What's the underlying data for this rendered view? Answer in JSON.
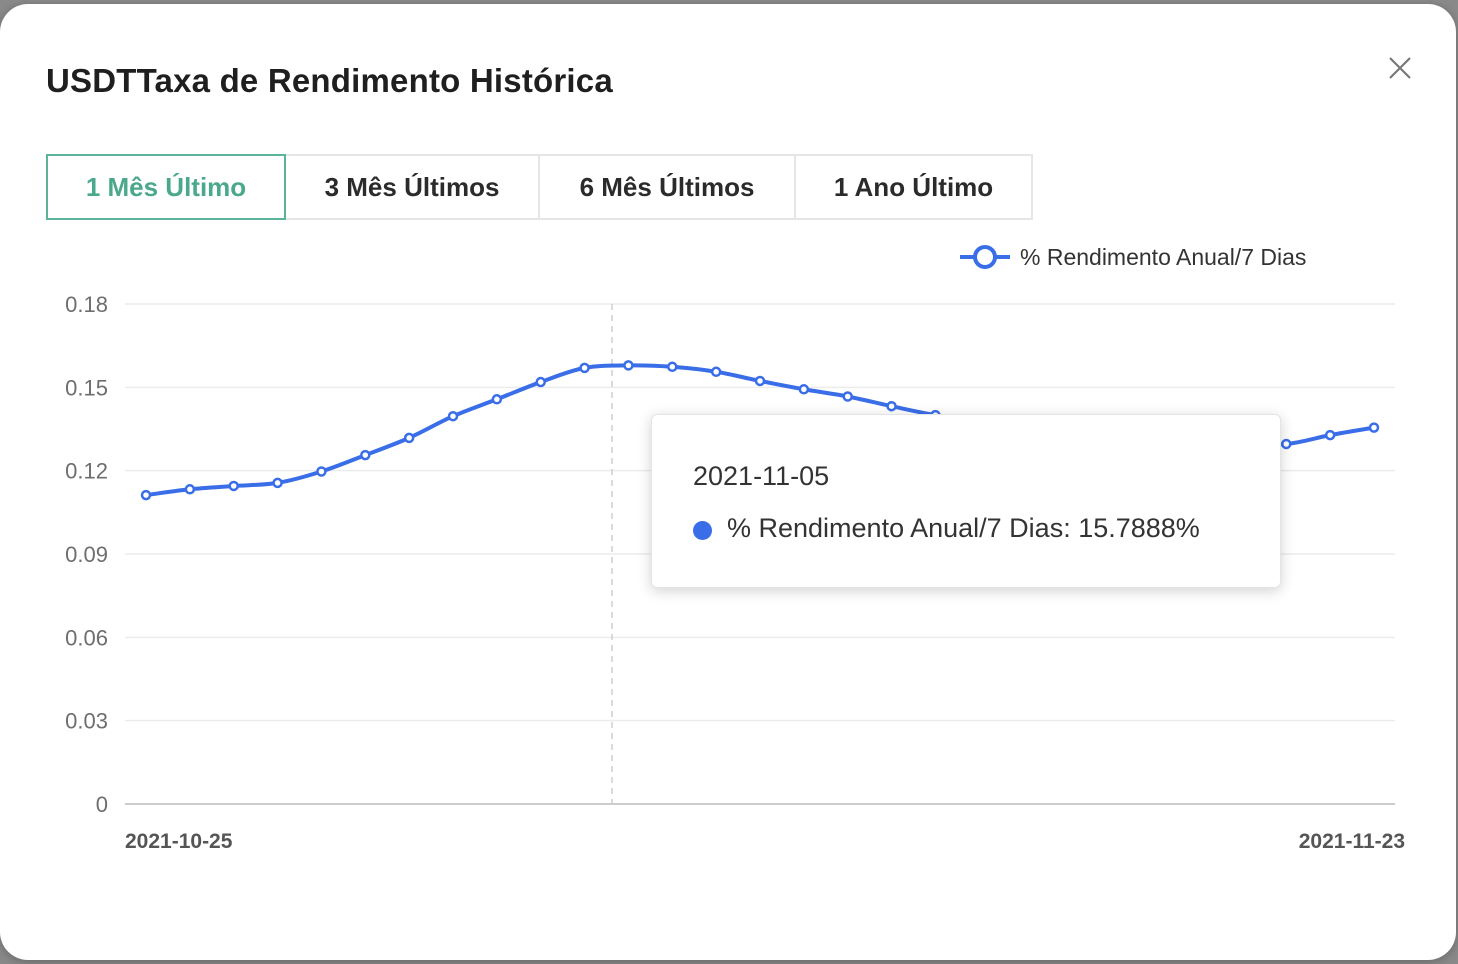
{
  "dialog": {
    "title": "USDTTaxa de Rendimento Histórica",
    "close_icon": "close-icon"
  },
  "tabs": [
    {
      "label": "1 Mês Último",
      "active": true
    },
    {
      "label": "3 Mês Últimos",
      "active": false
    },
    {
      "label": "6 Mês Últimos",
      "active": false
    },
    {
      "label": "1 Ano Último",
      "active": false
    }
  ],
  "colors": {
    "accent": "#4aa88c",
    "series": "#3a6ee8"
  },
  "tooltip": {
    "date": "2021-11-05",
    "text": "% Rendimento Anual/7 Dias: 15.7888%"
  },
  "chart_data": {
    "type": "line",
    "legend": "% Rendimento Anual/7 Dias",
    "legend_position": "top-right",
    "ylim": [
      0,
      0.18
    ],
    "yticks": [
      "0",
      "0.03",
      "0.06",
      "0.09",
      "0.12",
      "0.15",
      "0.18"
    ],
    "xtick_labels": [
      "2021-10-25",
      "2021-11-23"
    ],
    "grid": true,
    "series": [
      {
        "name": "% Rendimento Anual/7 Dias",
        "values": [
          0.1112,
          0.1133,
          0.1145,
          0.1156,
          0.1197,
          0.1256,
          0.1318,
          0.1396,
          0.1457,
          0.1519,
          0.157,
          0.1579,
          0.1574,
          0.1556,
          0.1523,
          0.1493,
          0.1467,
          0.1432,
          0.14,
          0.138,
          0.1362,
          0.1345,
          0.133,
          0.1318,
          0.1306,
          0.1298,
          0.1296,
          0.1328,
          0.1355
        ]
      }
    ]
  }
}
